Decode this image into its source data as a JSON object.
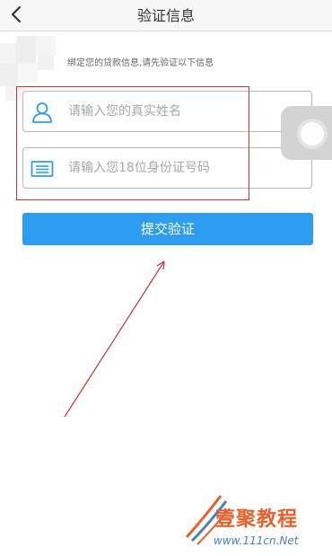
{
  "navbar": {
    "title": "验证信息"
  },
  "main": {
    "hint": "绑定您的贷款信息,请先验证以下信息",
    "name_field": {
      "placeholder": "请输入您的真实姓名",
      "value": ""
    },
    "id_field": {
      "placeholder": "请输入您18位身份证号码",
      "value": ""
    },
    "submit_label": "提交验证"
  },
  "watermark": {
    "brand": "壹聚教程",
    "url": "www.111cn.Net"
  },
  "colors": {
    "accent": "#2e9cf0",
    "annotation": "#c7343b",
    "icon": "#2e9cf0",
    "watermark_brand": "#e8612c",
    "watermark_url": "#4a7fc0"
  },
  "icons": {
    "back": "chevron-left-icon",
    "name": "user-icon",
    "id": "id-card-icon",
    "float": "assistive-touch-icon"
  }
}
